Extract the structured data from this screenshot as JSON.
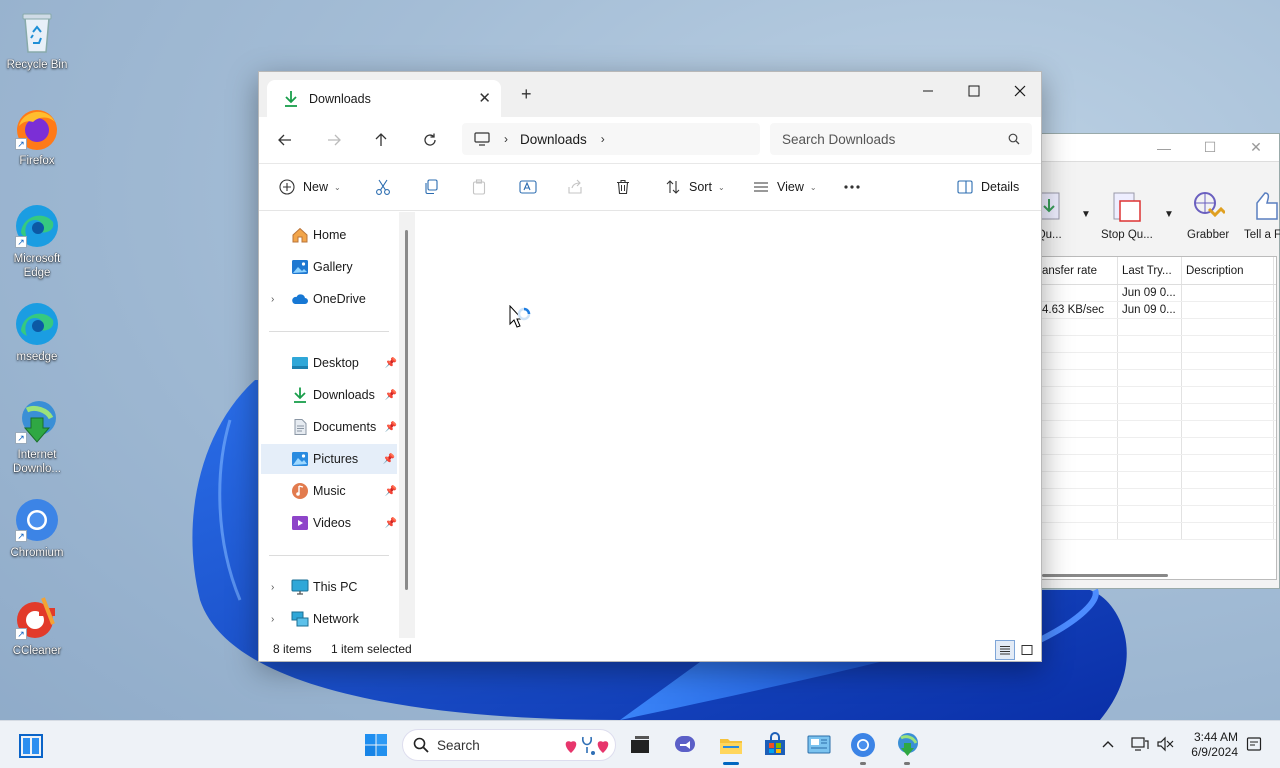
{
  "desktop": {
    "icons": [
      {
        "label": "Recycle Bin",
        "icon": "recycle-bin-icon"
      },
      {
        "label": "Firefox",
        "icon": "firefox-icon"
      },
      {
        "label": "Microsoft Edge",
        "icon": "edge-icon"
      },
      {
        "label": "msedge",
        "icon": "edge-icon"
      },
      {
        "label": "Internet Downlo...",
        "icon": "idm-icon"
      },
      {
        "label": "Chromium",
        "icon": "chromium-icon"
      },
      {
        "label": "CCleaner",
        "icon": "ccleaner-icon"
      }
    ]
  },
  "idm_window": {
    "toolbar": [
      {
        "label": "t Qu..."
      },
      {
        "label": "Stop Qu..."
      },
      {
        "label": "Grabber"
      },
      {
        "label": "Tell a Fr"
      }
    ],
    "columns": [
      "ansfer rate",
      "Last Try...",
      "Description"
    ],
    "rows": [
      {
        "rate": "",
        "last_try": "Jun 09 0...",
        "description": ""
      },
      {
        "rate": "4.63  KB/sec",
        "last_try": "Jun 09 0...",
        "description": ""
      }
    ]
  },
  "explorer": {
    "tab_title": "Downloads",
    "address": {
      "crumb": "Downloads"
    },
    "search_placeholder": "Search Downloads",
    "commands": {
      "new": "New",
      "sort": "Sort",
      "view": "View",
      "details": "Details"
    },
    "sidebar": {
      "home": "Home",
      "gallery": "Gallery",
      "onedrive": "OneDrive",
      "desktop": "Desktop",
      "downloads": "Downloads",
      "documents": "Documents",
      "pictures": "Pictures",
      "music": "Music",
      "videos": "Videos",
      "this_pc": "This PC",
      "network": "Network"
    },
    "status": {
      "items": "8 items",
      "selected": "1 item selected"
    }
  },
  "taskbar": {
    "search_label": "Search",
    "time": "3:44 AM",
    "date": "6/9/2024"
  },
  "colors": {
    "accent": "#0067c0",
    "selection": "#e5eef9",
    "download_green": "#1a9e4b"
  }
}
